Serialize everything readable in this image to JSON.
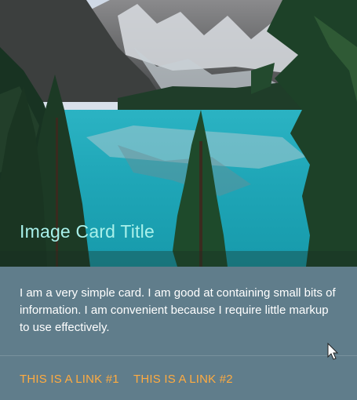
{
  "card": {
    "title": "Image Card Title",
    "image_description_icon": "landscape-photo",
    "text": "I am a very simple card. I am good at containing small bits of information. I am convenient because I require little markup to use effectively.",
    "links": [
      "THIS IS A LINK #1",
      "THIS IS A LINK #2"
    ]
  },
  "colors": {
    "card_background": "#607d8b",
    "title_color": "#a8f0ea",
    "link_color": "#ffab40"
  }
}
